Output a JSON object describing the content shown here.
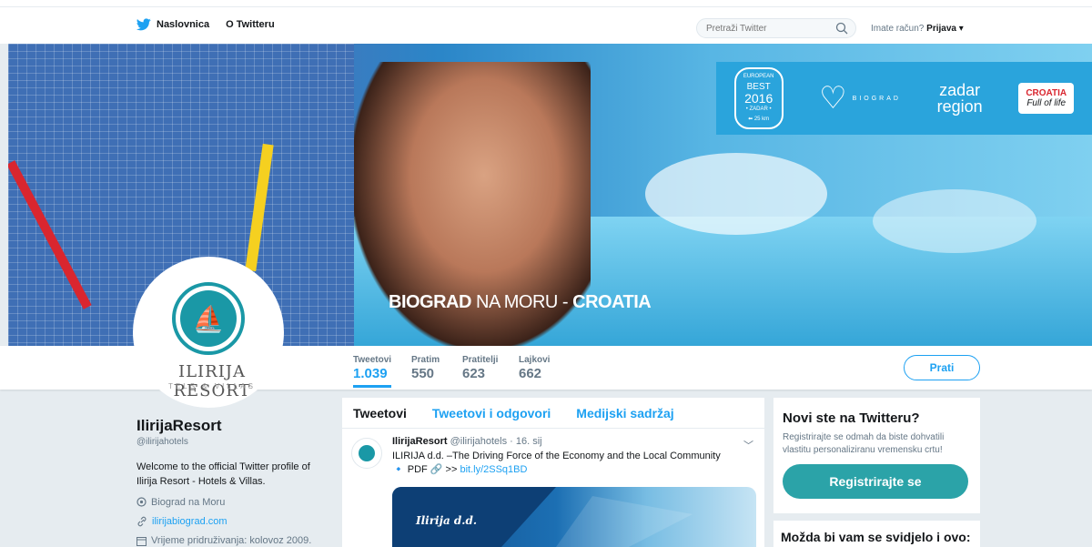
{
  "nav": {
    "home_label": "Naslovnica",
    "about_label": "O Twitteru",
    "search_placeholder": "Pretraži Twitter",
    "login_prefix": "Imate račun?",
    "login_label": "Prijava ▾"
  },
  "banner": {
    "caption_bold": "BIOGRAD",
    "caption_mid": " NA MORU - ",
    "caption_end": "CROATIA",
    "badge_best_line1": "EUROPEAN",
    "badge_best_line2": "BEST",
    "badge_best_line3": "2016",
    "badge_best_line4": "• ZADAR •",
    "badge_best_distance": "⬅ 25 km",
    "badge_biograd": "BIOGRAD",
    "badge_zadar_1": "zadar",
    "badge_zadar_2": "region",
    "badge_croatia_1": "CROATIA",
    "badge_croatia_2": "Full of life"
  },
  "profile_logo": {
    "text": "ILIRIJA RESORT",
    "sub": "TELS & VILLAS"
  },
  "stats": [
    {
      "label": "Tweetovi",
      "value": "1.039"
    },
    {
      "label": "Pratim",
      "value": "550"
    },
    {
      "label": "Pratitelji",
      "value": "623"
    },
    {
      "label": "Lajkovi",
      "value": "662"
    }
  ],
  "follow_label": "Prati",
  "profile": {
    "name": "IlirijaResort",
    "handle": "@ilirijahotels",
    "bio": "Welcome to the official Twitter profile of Ilirija Resort - Hotels & Villas.",
    "location": "Biograd na Moru",
    "website": "ilirijabiograd.com",
    "joined": "Vrijeme pridruživanja: kolovoz 2009."
  },
  "timeline": {
    "tabs": [
      "Tweetovi",
      "Tweetovi i odgovori",
      "Medijski sadržaj"
    ],
    "tweet": {
      "name": "IlirijaResort",
      "handle": "@ilirijahotels · 16. sij",
      "text": "ILIRIJA d.d. –The Driving Force of the Economy and the Local Community",
      "text2": "🔹 PDF 🔗 >> ",
      "link": "bit.ly/2SSq1BD",
      "media_logo": "Ilirija d.d."
    }
  },
  "signup": {
    "title": "Novi ste na Twitteru?",
    "text": "Registrirajte se odmah da biste dohvatili vlastitu personaliziranu vremensku crtu!",
    "button": "Registrirajte se"
  },
  "suggestions": {
    "title": "Možda bi vam se svidjelo i ovo:"
  },
  "colors": {
    "accent": "#1da1f2",
    "brand_teal": "#1a98a6",
    "signup_button": "#2ba3a8"
  }
}
